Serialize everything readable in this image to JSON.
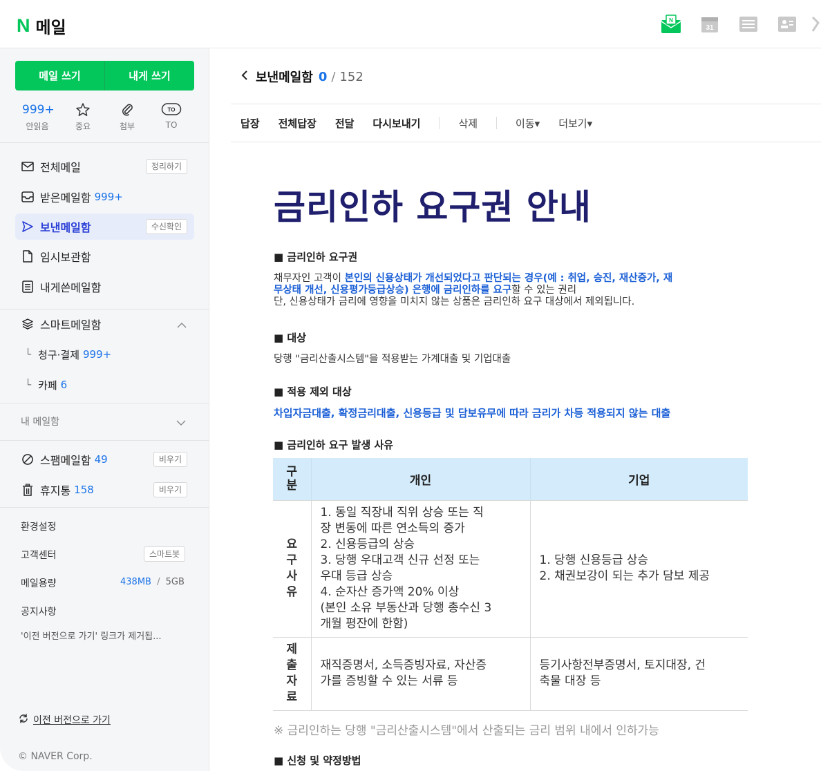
{
  "header": {
    "logo_n": "N",
    "app_title": "메일",
    "calendar_day": "31"
  },
  "sidebar": {
    "compose_label": "메일 쓰기",
    "self_compose_label": "내게 쓰기",
    "quick": [
      {
        "top": "999+",
        "label": "안읽음"
      },
      {
        "top": "☆",
        "label": "중요"
      },
      {
        "top": "",
        "label": "첨부"
      },
      {
        "top": "TO",
        "label": "TO"
      }
    ],
    "folders": [
      {
        "label": "전체메일",
        "count": "",
        "action": "정리하기"
      },
      {
        "label": "받은메일함",
        "count": "999+",
        "action": ""
      },
      {
        "label": "보낸메일함",
        "count": "",
        "action": "수신확인"
      },
      {
        "label": "임시보관함",
        "count": "",
        "action": ""
      },
      {
        "label": "내게쓴메일함",
        "count": "",
        "action": ""
      }
    ],
    "smart": {
      "label": "스마트메일함"
    },
    "smart_subs": [
      {
        "label": "청구·결제",
        "count": "999+"
      },
      {
        "label": "카페",
        "count": "6"
      }
    ],
    "my_folders": "내 메일함",
    "spam": {
      "label": "스팸메일함",
      "count": "49",
      "action": "비우기"
    },
    "trash": {
      "label": "휴지통",
      "count": "158",
      "action": "비우기"
    },
    "settings": "환경설정",
    "support": {
      "label": "고객센터",
      "action": "스마트봇"
    },
    "storage": {
      "label": "메일용량",
      "used": "438MB",
      "sep": "/",
      "total": "5GB"
    },
    "notice": {
      "label": "공지사항",
      "text": "'이전 버전으로 가기' 링크가 제거됩..."
    },
    "prev_version": "이전 버전으로 가기",
    "copyright": "© NAVER Corp."
  },
  "main": {
    "folder_title": "보낸메일함",
    "unread": "0",
    "slash": "/",
    "total": "152",
    "toolbar": [
      "답장",
      "전체답장",
      "전달",
      "다시보내기",
      "삭제",
      "이동▾",
      "더보기▾"
    ],
    "mail": {
      "title": "금리인하 요구권 안내",
      "s1_title": "■ 금리인하 요구권",
      "s1_line1_a": "채무자인 고객이 ",
      "s1_line1_b": "본인의 신용상태가 개선되었다고 판단되는 경우(예 : 취업, 승진, 재산증가, 재",
      "s1_line2_a": "무상태 개선, 신용평가등급상승) 은행에 금리인하를 요구",
      "s1_line2_b": "할 수 있는 권리",
      "s1_line3": "단, 신용상태가 금리에 영향을 미치지 않는 상품은 금리인하 요구 대상에서 제외됩니다.",
      "s2_title": "■ 대상",
      "s2_text": "당행 \"금리산출시스템\"을 적용받는 가계대출 및 기업대출",
      "s3_title": "■ 적용 제외 대상",
      "s3_text": "차입자금대출, 확정금리대출, 신용등급 및 담보유무에 따라 금리가 차등 적용되지 않는 대출",
      "s4_title": "■ 금리인하 요구 발생 사유",
      "table": {
        "headers": [
          "구분",
          "개인",
          "기업"
        ],
        "rows": [
          {
            "category": "요구사유",
            "personal": [
              "1. 동일 직장내 직위 상승 또는 직",
              "장 변동에 따른 연소득의 증가",
              "2. 신용등급의 상승",
              "3. 당행 우대고객 신규 선정 또는",
              "우대 등급 상승",
              "4. 순자산 증가액 20% 이상",
              "(본인 소유 부동산과 당행 총수신 3",
              "개월 평잔에 한함)"
            ],
            "corporate": [
              "1. 당행 신용등급 상승",
              "2. 채권보강이 되는 추가 담보 제공"
            ]
          },
          {
            "category": "제출자료",
            "personal": [
              "재직증명서, 소득증빙자료, 자산증",
              "가를 증빙할 수 있는 서류 등"
            ],
            "corporate": [
              "등기사항전부증명서, 토지대장, 건",
              "축물 대장 등"
            ]
          }
        ]
      },
      "note": "※ 금리인하는 당행 \"금리산출시스템\"에서 산출되는 금리 범위 내에서 인하가능",
      "s5_title": "■ 신청 및 약정방법"
    }
  }
}
